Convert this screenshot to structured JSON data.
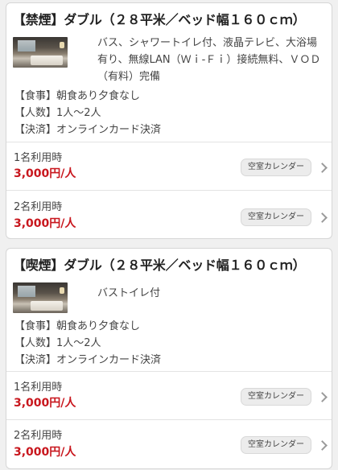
{
  "rooms": [
    {
      "title": "【禁煙】ダブル（２８平米／ベッド幅１６０ｃｍ）",
      "description": "バス、シャワートイレ付、液晶テレビ、大浴場有り、無線LAN（Ｗｉ-Ｆｉ）接続無料、ＶＯＤ（有料）完備",
      "meal": "【食事】朝食あり夕食なし",
      "guests": "【人数】1人～2人",
      "payment": "【決済】オンラインカード決済",
      "plans": [
        {
          "label": "1名利用時",
          "price": "3,000円/人",
          "button": "空室カレンダー"
        },
        {
          "label": "2名利用時",
          "price": "3,000円/人",
          "button": "空室カレンダー"
        }
      ]
    },
    {
      "title": "【喫煙】ダブル（２８平米／ベッド幅１６０ｃｍ）",
      "description": "バストイレ付",
      "meal": "【食事】朝食あり夕食なし",
      "guests": "【人数】1人～2人",
      "payment": "【決済】オンラインカード決済",
      "plans": [
        {
          "label": "1名利用時",
          "price": "3,000円/人",
          "button": "空室カレンダー"
        },
        {
          "label": "2名利用時",
          "price": "3,000円/人",
          "button": "空室カレンダー"
        }
      ]
    }
  ],
  "colors": {
    "price": "#c8161d",
    "background": "#f0f0f0",
    "card": "#ffffff",
    "button_bg": "#ececec"
  },
  "icons": {
    "chevron": "chevron-right-icon"
  }
}
